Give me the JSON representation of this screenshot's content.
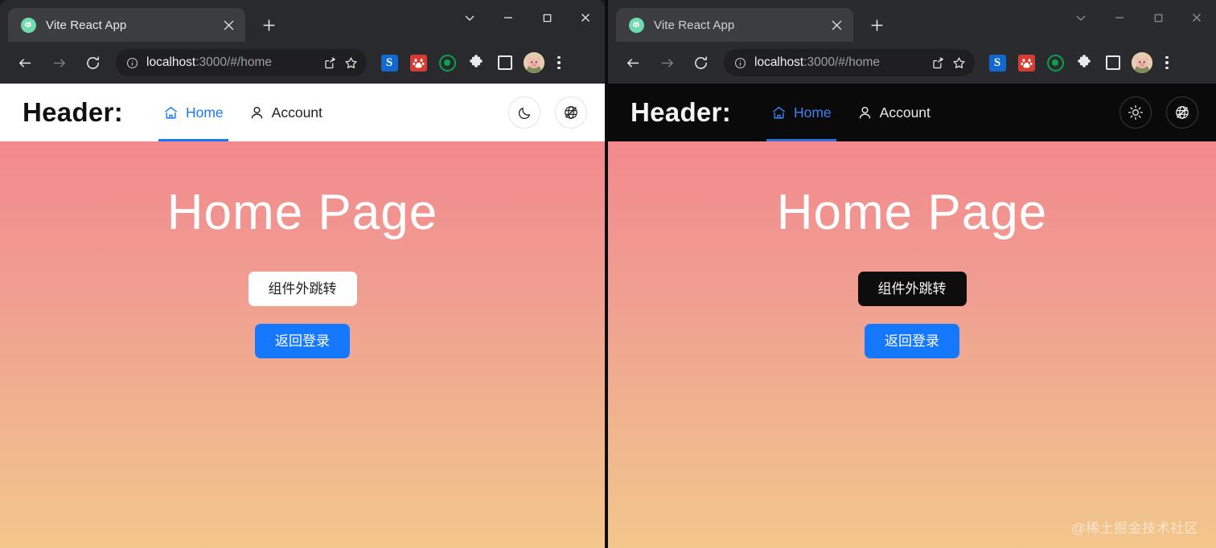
{
  "browser": {
    "tab": {
      "title": "Vite React App",
      "favicon_icon": "rabbit-favicon",
      "close_icon": "close-icon"
    },
    "new_tab_icon": "plus-icon",
    "window_controls": {
      "tablist_icon": "chevron-down-icon",
      "minimize_icon": "minimize-icon",
      "maximize_icon": "maximize-icon",
      "close_icon": "close-icon"
    },
    "toolbar": {
      "back_icon": "back-arrow-icon",
      "forward_icon": "forward-arrow-icon",
      "reload_icon": "reload-icon",
      "site_info_icon": "info-circle-icon",
      "url_host": "localhost",
      "url_rest": ":3000/#/home",
      "url_full": "localhost:3000/#/home",
      "share_icon": "share-icon",
      "bookmark_icon": "star-icon",
      "extensions": [
        {
          "name": "sogou-extension-icon",
          "label": "S"
        },
        {
          "name": "baidu-extension-icon",
          "label": ""
        },
        {
          "name": "target-ring-extension-icon",
          "label": ""
        },
        {
          "name": "puzzle-extensions-icon",
          "label": ""
        },
        {
          "name": "sidepanel-icon",
          "label": ""
        }
      ],
      "avatar_icon": "profile-avatar",
      "menu_icon": "kebab-menu-icon"
    }
  },
  "app": {
    "brand": "Header:",
    "nav": [
      {
        "label": "Home",
        "icon": "home-icon",
        "active": true
      },
      {
        "label": "Account",
        "icon": "user-icon",
        "active": false
      }
    ],
    "actions_light": [
      {
        "name": "theme-toggle-button",
        "icon": "moon-icon"
      },
      {
        "name": "language-toggle-button",
        "icon": "globe-slash-icon"
      }
    ],
    "actions_dark": [
      {
        "name": "theme-toggle-button",
        "icon": "sun-icon"
      },
      {
        "name": "language-toggle-button",
        "icon": "globe-slash-icon"
      }
    ],
    "hero": {
      "title": "Home Page",
      "ghost_button": "组件外跳转",
      "primary_button": "返回登录"
    },
    "watermark": "@稀土掘金技术社区"
  },
  "colors": {
    "accent_blue": "#1677ff",
    "gradient_top": "#f2898e",
    "gradient_bottom": "#f3c68c",
    "light_bg": "#ffffff",
    "dark_bg": "#000000",
    "chrome_bg": "#292a2d"
  }
}
